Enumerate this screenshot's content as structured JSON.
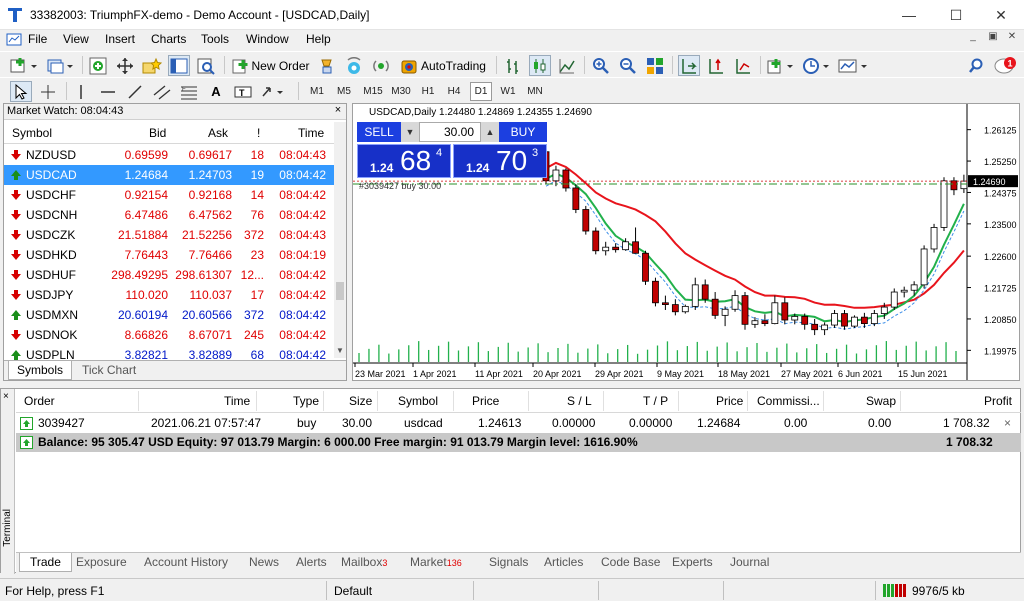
{
  "window": {
    "title": "33382003: TriumphFX-demo - Demo Account - [USDCAD,Daily]"
  },
  "menu": [
    "File",
    "View",
    "Insert",
    "Charts",
    "Tools",
    "Window",
    "Help"
  ],
  "toolbar": {
    "new_order_label": "New Order",
    "autotrading_label": "AutoTrading",
    "timeframes": [
      "M1",
      "M5",
      "M15",
      "M30",
      "H1",
      "H4",
      "D1",
      "W1",
      "MN"
    ],
    "active_timeframe": "D1"
  },
  "market_watch": {
    "title": "Market Watch: 08:04:43",
    "columns": [
      "Symbol",
      "Bid",
      "Ask",
      "!",
      "Time"
    ],
    "rows": [
      {
        "symbol": "NZDUSD",
        "bid": "0.69599",
        "ask": "0.69617",
        "spread": "18",
        "time": "08:04:43",
        "dir": "down",
        "color": "red"
      },
      {
        "symbol": "USDCAD",
        "bid": "1.24684",
        "ask": "1.24703",
        "spread": "19",
        "time": "08:04:42",
        "dir": "up",
        "color": "blue"
      },
      {
        "symbol": "USDCHF",
        "bid": "0.92154",
        "ask": "0.92168",
        "spread": "14",
        "time": "08:04:42",
        "dir": "down",
        "color": "red"
      },
      {
        "symbol": "USDCNH",
        "bid": "6.47486",
        "ask": "6.47562",
        "spread": "76",
        "time": "08:04:42",
        "dir": "down",
        "color": "red"
      },
      {
        "symbol": "USDCZK",
        "bid": "21.51884",
        "ask": "21.52256",
        "spread": "372",
        "time": "08:04:43",
        "dir": "down",
        "color": "red"
      },
      {
        "symbol": "USDHKD",
        "bid": "7.76443",
        "ask": "7.76466",
        "spread": "23",
        "time": "08:04:19",
        "dir": "down",
        "color": "red"
      },
      {
        "symbol": "USDHUF",
        "bid": "298.49295",
        "ask": "298.61307",
        "spread": "12...",
        "time": "08:04:42",
        "dir": "down",
        "color": "red"
      },
      {
        "symbol": "USDJPY",
        "bid": "110.020",
        "ask": "110.037",
        "spread": "17",
        "time": "08:04:42",
        "dir": "down",
        "color": "red"
      },
      {
        "symbol": "USDMXN",
        "bid": "20.60194",
        "ask": "20.60566",
        "spread": "372",
        "time": "08:04:42",
        "dir": "up",
        "color": "blue"
      },
      {
        "symbol": "USDNOK",
        "bid": "8.66826",
        "ask": "8.67071",
        "spread": "245",
        "time": "08:04:42",
        "dir": "down",
        "color": "red"
      },
      {
        "symbol": "USDPLN",
        "bid": "3.82821",
        "ask": "3.82889",
        "spread": "68",
        "time": "08:04:42",
        "dir": "up",
        "color": "blue"
      }
    ],
    "selected_index": 1,
    "tabs": [
      "Symbols",
      "Tick Chart"
    ]
  },
  "chart": {
    "header": "USDCAD,Daily  1.24480 1.24869 1.24355 1.24690",
    "sell_label": "SELL",
    "buy_label": "BUY",
    "volume": "30.00",
    "sell_price_prefix": "1.24",
    "sell_price_big": "68",
    "sell_price_sup": "4",
    "buy_price_prefix": "1.24",
    "buy_price_big": "70",
    "buy_price_sup": "3",
    "order_line_label": "#3039427 buy 30.00",
    "current_price": "1.24690"
  },
  "chart_data": {
    "type": "candlestick",
    "title": "USDCAD,Daily",
    "y_ticks": [
      "1.26125",
      "1.25250",
      "1.24375",
      "1.23500",
      "1.22600",
      "1.21725",
      "1.20850",
      "1.19975"
    ],
    "ylim": [
      1.1965,
      1.2645
    ],
    "x_ticks": [
      "23 Mar 2021",
      "1 Apr 2021",
      "11 Apr 2021",
      "20 Apr 2021",
      "29 Apr 2021",
      "9 May 2021",
      "18 May 2021",
      "27 May 2021",
      "6 Jun 2021",
      "15 Jun 2021"
    ],
    "candles": [
      [
        1.2551,
        1.256,
        1.2462,
        1.247
      ],
      [
        1.247,
        1.2512,
        1.2455,
        1.25
      ],
      [
        1.25,
        1.2505,
        1.244,
        1.245
      ],
      [
        1.245,
        1.246,
        1.238,
        1.239
      ],
      [
        1.239,
        1.24,
        1.232,
        1.233
      ],
      [
        1.233,
        1.234,
        1.2265,
        1.2275
      ],
      [
        1.2275,
        1.23,
        1.2262,
        1.2285
      ],
      [
        1.2285,
        1.2296,
        1.227,
        1.2278
      ],
      [
        1.2278,
        1.231,
        1.2275,
        1.23
      ],
      [
        1.23,
        1.234,
        1.2285,
        1.2268
      ],
      [
        1.2268,
        1.2275,
        1.218,
        1.219
      ],
      [
        1.219,
        1.22,
        1.212,
        1.213
      ],
      [
        1.213,
        1.215,
        1.211,
        1.2125
      ],
      [
        1.2125,
        1.214,
        1.2095,
        1.2105
      ],
      [
        1.2105,
        1.2125,
        1.21,
        1.212
      ],
      [
        1.212,
        1.22,
        1.211,
        1.218
      ],
      [
        1.218,
        1.2195,
        1.213,
        1.214
      ],
      [
        1.214,
        1.216,
        1.2085,
        1.2095
      ],
      [
        1.2095,
        1.212,
        1.2065,
        1.2112
      ],
      [
        1.2112,
        1.2165,
        1.2105,
        1.215
      ],
      [
        1.215,
        1.216,
        1.2055,
        1.207
      ],
      [
        1.207,
        1.209,
        1.206,
        1.208
      ],
      [
        1.208,
        1.2098,
        1.2065,
        1.2072
      ],
      [
        1.2072,
        1.215,
        1.207,
        1.213
      ],
      [
        1.213,
        1.2145,
        1.207,
        1.2082
      ],
      [
        1.2082,
        1.21,
        1.207,
        1.2092
      ],
      [
        1.2092,
        1.21,
        1.2055,
        1.207
      ],
      [
        1.207,
        1.2085,
        1.204,
        1.2055
      ],
      [
        1.2055,
        1.2075,
        1.204,
        1.2068
      ],
      [
        1.2068,
        1.211,
        1.206,
        1.21
      ],
      [
        1.21,
        1.211,
        1.2055,
        1.2065
      ],
      [
        1.2065,
        1.2095,
        1.206,
        1.209
      ],
      [
        1.209,
        1.2102,
        1.206,
        1.2072
      ],
      [
        1.2072,
        1.211,
        1.2065,
        1.21
      ],
      [
        1.21,
        1.213,
        1.2085,
        1.2118
      ],
      [
        1.2118,
        1.217,
        1.211,
        1.216
      ],
      [
        1.216,
        1.2175,
        1.2145,
        1.2165
      ],
      [
        1.2165,
        1.219,
        1.215,
        1.218
      ],
      [
        1.218,
        1.229,
        1.217,
        1.228
      ],
      [
        1.228,
        1.235,
        1.227,
        1.234
      ],
      [
        1.234,
        1.248,
        1.233,
        1.247
      ],
      [
        1.247,
        1.248,
        1.243,
        1.2445
      ],
      [
        1.2448,
        1.2487,
        1.2436,
        1.2469
      ]
    ],
    "order_level": 1.2461,
    "current_level": 1.2469
  },
  "terminal": {
    "side_label": "Terminal",
    "columns": [
      "Order",
      "Time",
      "Type",
      "Size",
      "Symbol",
      "Price",
      "S / L",
      "T / P",
      "Price",
      "Commissi...",
      "Swap",
      "Profit"
    ],
    "order": {
      "order": "3039427",
      "time": "2021.06.21 07:57:47",
      "type": "buy",
      "size": "30.00",
      "symbol": "usdcad",
      "price": "1.24613",
      "sl": "0.00000",
      "tp": "0.00000",
      "cur_price": "1.24684",
      "commission": "0.00",
      "swap": "0.00",
      "profit": "1 708.32"
    },
    "balance_line": "Balance: 95 305.47 USD  Equity: 97 013.79  Margin: 6 000.00  Free margin: 91 013.79  Margin level: 1616.90%",
    "balance_profit": "1 708.32",
    "tabs": [
      {
        "label": "Trade",
        "badge": ""
      },
      {
        "label": "Exposure",
        "badge": ""
      },
      {
        "label": "Account History",
        "badge": ""
      },
      {
        "label": "News",
        "badge": ""
      },
      {
        "label": "Alerts",
        "badge": ""
      },
      {
        "label": "Mailbox",
        "badge": "3"
      },
      {
        "label": "Market",
        "badge": "136"
      },
      {
        "label": "Signals",
        "badge": ""
      },
      {
        "label": "Articles",
        "badge": ""
      },
      {
        "label": "Code Base",
        "badge": ""
      },
      {
        "label": "Experts",
        "badge": ""
      },
      {
        "label": "Journal",
        "badge": ""
      }
    ]
  },
  "status": {
    "help": "For Help, press F1",
    "profile": "Default",
    "traffic": "9976/5 kb"
  },
  "colors": {
    "bull": "#ffffff",
    "bear": "#c00000",
    "ma_fast": "#22b14c",
    "ma_slow": "#e8141c",
    "volume": "#22b14c",
    "accent": "#3399ff"
  }
}
